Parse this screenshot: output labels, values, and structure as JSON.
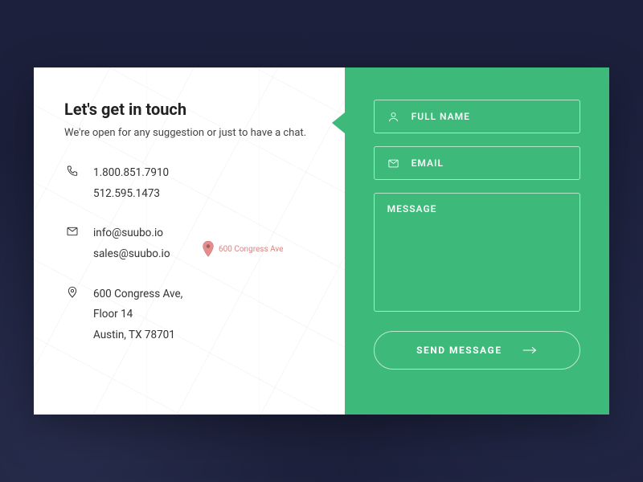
{
  "left": {
    "title": "Let's get in touch",
    "subtitle": "We're open for any suggestion or just to have a chat.",
    "phone": {
      "line1": "1.800.851.7910",
      "line2": "512.595.1473"
    },
    "email": {
      "line1": "info@suubo.io",
      "line2": "sales@suubo.io"
    },
    "address": {
      "line1": "600 Congress Ave,",
      "line2": "Floor 14",
      "line3": "Austin, TX 78701"
    },
    "map_pin_label": "600 Congress Ave"
  },
  "form": {
    "name_placeholder": "FULL NAME",
    "email_placeholder": "EMAIL",
    "message_placeholder": "MESSAGE",
    "submit_label": "SEND MESSAGE"
  },
  "colors": {
    "accent": "#3dba79",
    "page_bg": "#1f2340"
  }
}
